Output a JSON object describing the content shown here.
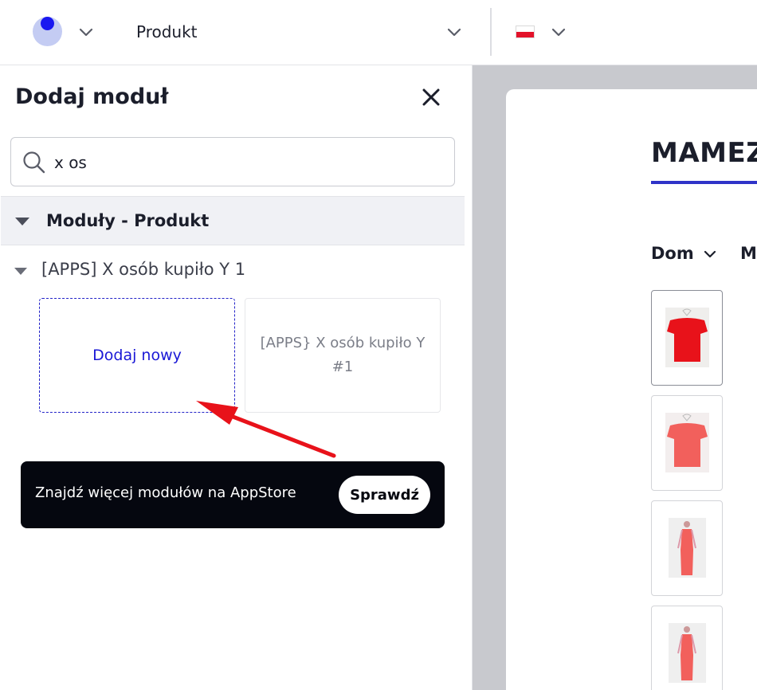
{
  "topbar": {
    "page_selector": "Produkt"
  },
  "panel": {
    "title": "Dodaj moduł",
    "search_value": "x os",
    "group_label": "Moduły - Produkt",
    "subgroup_label": "[APPS] X osób kupiło Y 1",
    "add_tile_label": "Dodaj nowy",
    "module_tile_label": "[APPS} X osób kupiło Y #1",
    "appstore_text": "Znajdź więcej modułów na AppStore",
    "appstore_button": "Sprawdź"
  },
  "preview": {
    "store_name": "MAMEZI",
    "nav_items": [
      "Dom",
      "Mo"
    ]
  },
  "colors": {
    "accent": "#1a18f0",
    "underline": "#2f33c8",
    "annotation_arrow": "#e8121a",
    "product_red": "#e8121a",
    "product_coral": "#f2605c"
  }
}
